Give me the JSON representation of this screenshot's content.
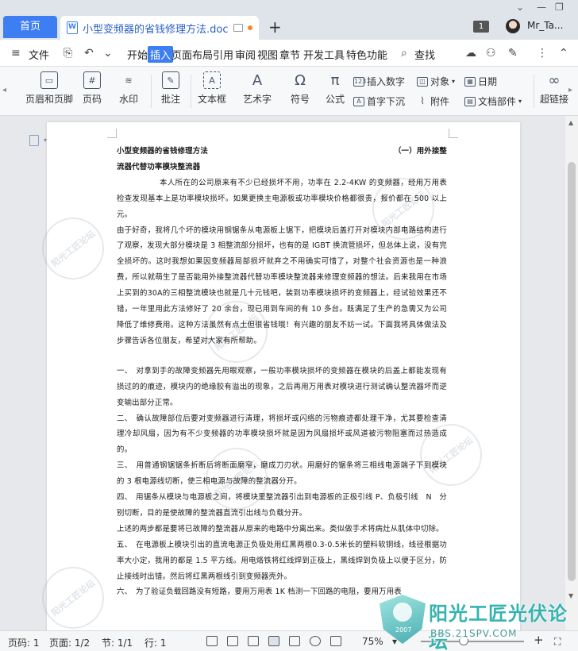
{
  "titlebar": {
    "home_tab": "首页",
    "doc_tab_title": "小型变频器的省钱修理方法.doc",
    "add_tab": "+",
    "badge_count": "1",
    "username": "Mr_Ta..."
  },
  "menubar": {
    "file": "文件",
    "items": [
      "开始",
      "插入",
      "页面布局",
      "引用",
      "审阅",
      "视图",
      "章节",
      "开发工具",
      "特色功能"
    ],
    "active": "插入",
    "search": "查找"
  },
  "ribbon": {
    "header_footer": "页眉和页脚",
    "page_number": "页码",
    "watermark": "水印",
    "comment": "批注",
    "textbox": "文本框",
    "wordart": "艺术字",
    "symbol": "符号",
    "formula": "公式",
    "insert_number": "插入数字",
    "drop_cap": "首字下沉",
    "object": "对象",
    "attachment": "附件",
    "date": "日期",
    "doc_parts": "文档部件",
    "hyperlink": "超链接"
  },
  "document": {
    "title_left": "小型变频器的省钱修理方法",
    "title_right": "（一）用外接整",
    "subtitle": "流器代替功率模块整流器",
    "paragraphs": [
      "本人所在的公司原来有不少已经损坏不用，功率在 2.2-4KW 的变频器，经用万用表检查发现基本上是功率模块损坏。如果更换主电源板或功率模块价格都很贵，报价都在 500 以上元。",
      "由于好奇，我将几个坏的模块用钢锯条从电源板上锯下，把模块后盖打开对模块内部电路结构进行了观察，发现大部分模块是 3 相整流部分损坏，也有的是 IGBT 换流管损坏，但总体上说，没有完全损坏的。这时我想如果因变频器局部损坏就弃之不用确实可惜了，对整个社会资源也是一种浪费，所以就萌生了是否能用外接整流器代替功率模块整流器来修理变频器的想法。后来我用在市场上买到的30A的三相整流模块也就是几十元钱吧，装到功率模块损坏的变频器上，经试验效果还不错，一年里用此方法修好了 20 余台，现已用到车间的有 10 多台。既满足了生产的急需又为公司降低了维修费用。这种方法虽然有点土但很省钱哦！有兴趣的朋友不妨一试。下面我将具体做法及步骤告诉各位朋友，希望对大家有所帮助。",
      "一、　对拿到手的故障变频器先用眼观察，一般功率模块损坏的变频器在模块的后盖上都能发现有损过的的痕迹，模块内的绝缘胶有溢出的现象，之后再用万用表对模块进行测试确认整流器坏而逆变输出部分正常。",
      "二、　确认故障部位后要对变频器进行清理，将损坏或闪络的污物痕迹都处理干净，尤其要检查清理冷却风扇，因为有不少变频器的功率模块损坏就是因为风扇损坏或风道被污物阻塞而过热造成的。",
      "三、　用普通钢锯锯条折断后将断面磨窄，磨成刀刃状。用磨好的锯条将三相线电源端子下到模块的 3 根电源线切断，使三相电源与故障的整流器分开。",
      "四、　用锯条从模块与电源板之间，将模块里整流器引出到电源板的正极引线 P、负极引线　N　分别切断，目的是使故障的整流器直流引出线与负载分开。",
      "上述的两步都是要将已故障的整流器从原来的电路中分离出来。类似做手术将病灶从肌体中切除。",
      "五、　在电源板上模块引出的直流电源正负极处用红黑两根0.3-0.5米长的塑料软铜线，线径根据功率大小定，我用的都是 1.5 平方线。用电烙铁将红线焊到正极上，黑线焊到负极上以便于区分，防止接线时出错。然后将红黑两根线引到变频器壳外。",
      "六、　为了验证负载回路没有短路，要用万用表 1K 档测一下回路的电阻，要用万用表"
    ]
  },
  "watermark_text": "阳光工匠论坛",
  "statusbar": {
    "page_code": "页码: 1",
    "page": "页面: 1/2",
    "section": "节: 1/1",
    "row": "行: 1",
    "zoom": "75%"
  },
  "corner_logo": {
    "year": "2007",
    "name": "阳光工匠光伏论坛",
    "url": "BBS.21SPV.COM"
  },
  "colors": {
    "accent": "#3d7ef3",
    "logo": "#36b3b0"
  }
}
